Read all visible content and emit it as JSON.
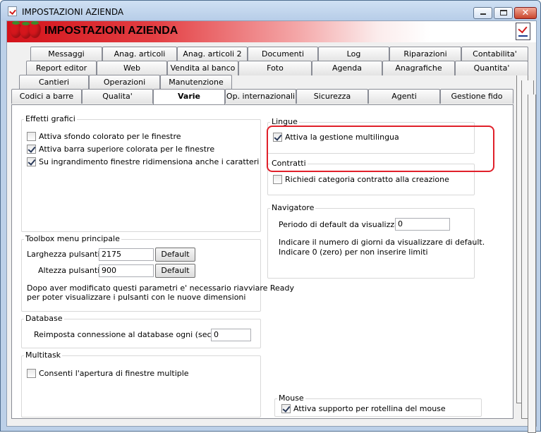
{
  "window": {
    "title": "IMPOSTAZIONI AZIENDA",
    "close_symbol": "✕"
  },
  "banner": {
    "title": "IMPOSTAZIONI AZIENDA"
  },
  "tabs": {
    "row1": [
      "Messaggi",
      "Anag. articoli",
      "Anag. articoli 2",
      "Documenti",
      "Log",
      "Riparazioni",
      "Contabilita'"
    ],
    "row2": [
      "Report editor",
      "Web",
      "Vendita al banco",
      "Foto",
      "Agenda",
      "Anagrafiche",
      "Quantita'"
    ],
    "row3": [
      "Cantieri",
      "Operazioni",
      "Manutenzione"
    ],
    "row4": [
      "Codici a barre",
      "Qualita'",
      "Varie",
      "Op. internazionali",
      "Sicurezza",
      "Agenti",
      "Gestione fido"
    ],
    "active": "Varie"
  },
  "effetti_grafici": {
    "title": "Effetti grafici",
    "options": [
      {
        "label": "Attiva sfondo colorato per le finestre",
        "checked": false
      },
      {
        "label": "Attiva barra superiore colorata per le finestre",
        "checked": true
      },
      {
        "label": "Su ingrandimento finestre ridimensiona anche i caratteri",
        "checked": true
      }
    ]
  },
  "toolbox": {
    "title": "Toolbox menu principale",
    "width_label": "Larghezza pulsanti :",
    "width_value": "2175",
    "height_label": "Altezza pulsanti :",
    "height_value": "900",
    "default_label": "Default",
    "note_line1": "Dopo aver modificato questi parametri e' necessario riavviare Ready",
    "note_line2": "per poter visualizzare i pulsanti con le nuove dimensioni"
  },
  "database": {
    "title": "Database",
    "label": "Reimposta connessione al database ogni (secondi) :",
    "value": "0"
  },
  "multitask": {
    "title": "Multitask",
    "option": {
      "label": "Consenti l'apertura di finestre multiple",
      "checked": false
    }
  },
  "lingue": {
    "title": "Lingue",
    "option": {
      "label": "Attiva la gestione multilingua",
      "checked": true
    }
  },
  "contratti": {
    "title": "Contratti",
    "option": {
      "label": "Richiedi categoria contratto alla creazione",
      "checked": false
    }
  },
  "navigatore": {
    "title": "Navigatore",
    "label": "Periodo di default da visualizzare :",
    "value": "0",
    "note_line1": "Indicare il numero di giorni da visualizzare di default.",
    "note_line2": "Indicare 0 (zero) per non inserire limiti"
  },
  "mouse": {
    "title": "Mouse",
    "option": {
      "label": "Attiva supporto per rotellina del mouse",
      "checked": true
    }
  },
  "colors": {
    "highlight": "#e0202a",
    "banner_red": "#d3121a"
  }
}
